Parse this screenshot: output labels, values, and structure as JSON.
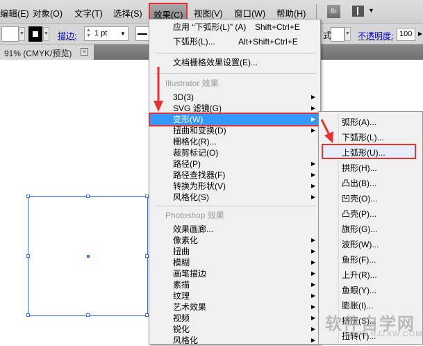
{
  "menubar": {
    "items": [
      "编辑(E)",
      "对象(O)",
      "文字(T)",
      "选择(S)",
      "效果(C)",
      "视图(V)",
      "窗口(W)",
      "帮助(H)"
    ],
    "bridge": "Br",
    "layout_icon": "workspace-layout-icon"
  },
  "toolbar": {
    "stroke_label": "描边:",
    "stroke_weight": "1 pt",
    "style_label": "式:",
    "opacity_label": "不透明度:",
    "opacity_value": "100"
  },
  "document": {
    "tab_label": "91% (CMYK/预览)",
    "close": "×"
  },
  "effect_menu": {
    "apply_last": {
      "label": "应用 “下弧形(L)” (A)",
      "shortcut": "Shift+Ctrl+E"
    },
    "last": {
      "label": "下弧形(L)...",
      "shortcut": "Alt+Shift+Ctrl+E"
    },
    "raster_settings": "文档栅格效果设置(E)...",
    "illustrator_header": "Illustrator 效果",
    "illustrator_items": [
      "3D(3)",
      "SVG 滤镜(G)",
      "变形(W)",
      "扭曲和变换(D)",
      "栅格化(R)...",
      "裁剪标记(O)",
      "路径(P)",
      "路径查找器(F)",
      "转换为形状(V)",
      "风格化(S)"
    ],
    "photoshop_header": "Photoshop 效果",
    "photoshop_items": [
      "效果画廊...",
      "像素化",
      "扭曲",
      "模糊",
      "画笔描边",
      "素描",
      "纹理",
      "艺术效果",
      "视频",
      "锐化",
      "风格化"
    ]
  },
  "warp_submenu": {
    "items": [
      "弧形(A)...",
      "下弧形(L)...",
      "上弧形(U)...",
      "拱形(H)...",
      "凸出(B)...",
      "凹壳(O)...",
      "凸壳(P)...",
      "旗形(G)...",
      "波形(W)...",
      "鱼形(F)...",
      "上升(R)...",
      "鱼眼(Y)...",
      "膨胀(I)...",
      "挤压(S)...",
      "扭转(T)..."
    ],
    "highlighted": "上弧形(U)..."
  },
  "watermark": {
    "text": "软件自学网",
    "url": "WWW.RJZXW.COM"
  },
  "colors": {
    "highlight": "#3399ff",
    "annotation": "#e8322f",
    "selection": "#3f6fe8"
  }
}
